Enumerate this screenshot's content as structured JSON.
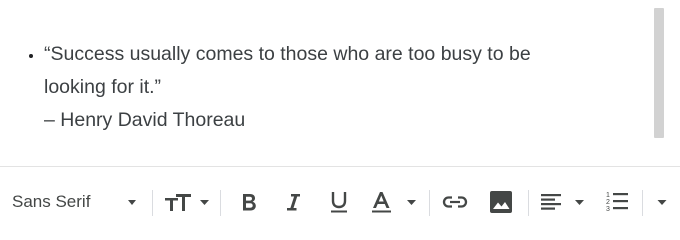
{
  "editor": {
    "list_items": [
      {
        "lines": [
          "“Success usually comes to those who are too busy to be",
          "looking for it.”",
          "– Henry David Thoreau"
        ]
      }
    ]
  },
  "toolbar": {
    "font_family_value": "Sans Serif",
    "icons": {
      "font_size": "text-size-icon",
      "bold": "bold-icon",
      "italic": "italic-icon",
      "underline": "underline-icon",
      "text_color": "text-color-icon",
      "link": "link-icon",
      "image": "image-icon",
      "align": "align-left-icon",
      "numbered_list": "numbered-list-icon",
      "more": "chevron-down-icon"
    }
  },
  "colors": {
    "text": "#3c4043",
    "icon": "#5f6368",
    "scrollbar": "#d2d2d2",
    "divider": "#dadce0"
  }
}
